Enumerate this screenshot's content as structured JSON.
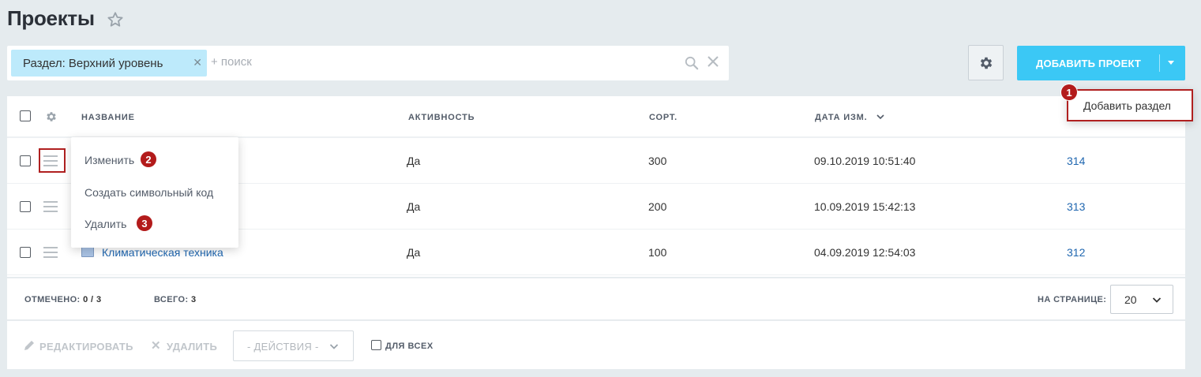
{
  "page": {
    "title": "Проекты"
  },
  "filter": {
    "chip_label": "Раздел: Верхний уровень",
    "search_placeholder": "+ поиск"
  },
  "toolbar": {
    "add_button_label": "ДОБАВИТЬ ПРОЕКТ"
  },
  "add_dropdown": {
    "item_label": "Добавить раздел"
  },
  "table": {
    "headers": {
      "name": "НАЗВАНИЕ",
      "activity": "АКТИВНОСТЬ",
      "sort": "СОРТ.",
      "date": "ДАТА ИЗМ."
    },
    "rows": [
      {
        "name": "",
        "activity": "Да",
        "sort": "300",
        "date": "09.10.2019 10:51:40",
        "id": "314"
      },
      {
        "name": "",
        "activity": "Да",
        "sort": "200",
        "date": "10.09.2019 15:42:13",
        "id": "313"
      },
      {
        "name": "Климатическая техника",
        "activity": "Да",
        "sort": "100",
        "date": "04.09.2019 12:54:03",
        "id": "312"
      }
    ]
  },
  "context_menu": {
    "items": [
      "Изменить",
      "Создать символьный код",
      "Удалить"
    ]
  },
  "badges": [
    "1",
    "2",
    "3"
  ],
  "footer": {
    "selected_label": "ОТМЕЧЕНО:",
    "selected_value": "0 / 3",
    "total_label": "ВСЕГО:",
    "total_value": "3",
    "per_page_label": "НА СТРАНИЦЕ:",
    "per_page_value": "20",
    "edit_label": "РЕДАКТИРОВАТЬ",
    "delete_label": "УДАЛИТЬ",
    "actions_label": "- ДЕЙСТВИЯ -",
    "for_all_label": "ДЛЯ ВСЕХ"
  },
  "colors": {
    "accent": "#3bc8f5",
    "chip": "#bdeafb",
    "link": "#2067b0",
    "annotation": "#b31b1b"
  },
  "icons": [
    "star-icon",
    "search-icon",
    "close-icon",
    "gear-icon",
    "chevron-down-icon",
    "burger-menu-icon",
    "folder-icon",
    "pencil-icon"
  ]
}
